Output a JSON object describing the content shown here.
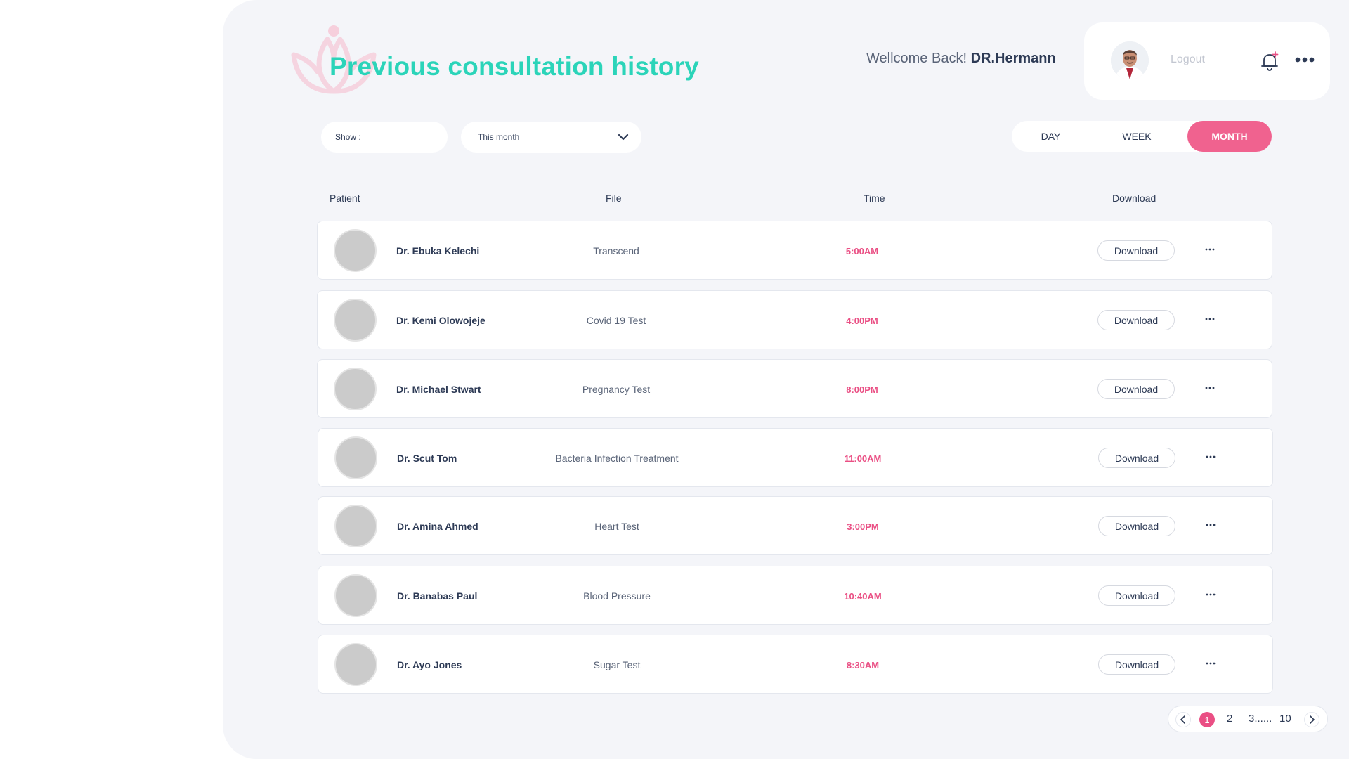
{
  "header": {
    "title": "Previous consultation history",
    "welcome_prefix": "Wellcome Back!",
    "welcome_name": "DR.Hermann",
    "logout_label": "Logout"
  },
  "filters": {
    "show_label": "Show :",
    "period_select_value": "This month",
    "period_toggle": [
      "DAY",
      "WEEK",
      "MONTH"
    ],
    "active_period": "MONTH"
  },
  "table": {
    "headers": [
      "Patient",
      "File",
      "Time",
      "Download"
    ],
    "rows": [
      {
        "patient": "Dr. Ebuka Kelechi",
        "file": "Transcend",
        "time": "5:00AM",
        "download_label": "Download"
      },
      {
        "patient": "Dr. Kemi Olowojeje",
        "file": "Covid 19 Test",
        "time": "4:00PM",
        "download_label": "Download"
      },
      {
        "patient": "Dr. Michael Stwart",
        "file": "Pregnancy Test",
        "time": "8:00PM",
        "download_label": "Download"
      },
      {
        "patient": "Dr. Scut Tom",
        "file": "Bacteria Infection Treatment",
        "time": "11:00AM",
        "download_label": "Download"
      },
      {
        "patient": "Dr. Amina Ahmed",
        "file": "Heart Test",
        "time": "3:00PM",
        "download_label": "Download"
      },
      {
        "patient": "Dr. Banabas Paul",
        "file": "Blood Pressure",
        "time": "10:40AM",
        "download_label": "Download"
      },
      {
        "patient": "Dr. Ayo Jones",
        "file": "Sugar Test",
        "time": "8:30AM",
        "download_label": "Download"
      }
    ]
  },
  "pagination": {
    "pages": [
      "1",
      "2",
      "3......",
      "10"
    ],
    "current": "1"
  },
  "colors": {
    "title": "#2bd4b9",
    "accent_pink": "#f0628f",
    "time_text": "#ea4f84",
    "panel_bg": "#f4f5f9"
  },
  "icons": {
    "logo": "lotus-logo-icon",
    "notifications": "bell-icon",
    "menu": "more-dots-icon",
    "select": "chevron-down-icon",
    "pager_prev": "chevron-left-icon",
    "pager_next": "chevron-right-icon"
  }
}
